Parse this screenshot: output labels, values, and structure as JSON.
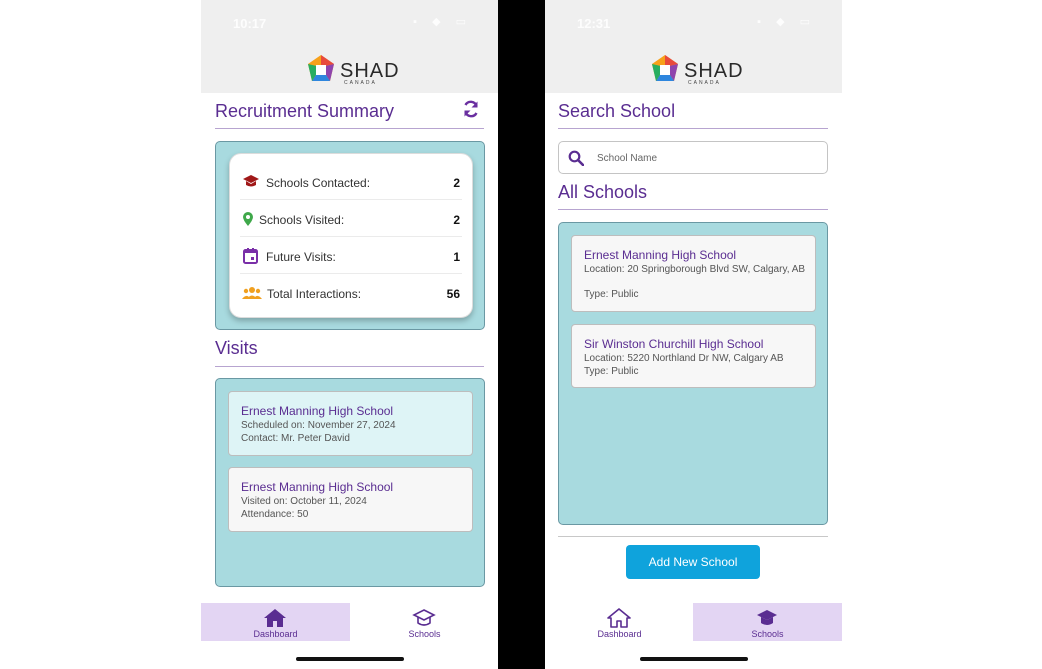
{
  "left_screen": {
    "status_time": "10:17",
    "brand": {
      "name": "SHAD",
      "sub": "CANADA"
    },
    "summary_title": "Recruitment Summary",
    "summary": [
      {
        "icon": "graduation-cap-icon",
        "label": "Schools Contacted:",
        "value": "2"
      },
      {
        "icon": "map-pin-icon",
        "label": "Schools Visited:",
        "value": "2"
      },
      {
        "icon": "calendar-icon",
        "label": "Future Visits:",
        "value": "1"
      },
      {
        "icon": "users-icon",
        "label": "Total Interactions:",
        "value": "56"
      }
    ],
    "visits_title": "Visits",
    "visits": [
      {
        "school": "Ernest Manning High School",
        "line1": "Scheduled on: November 27, 2024",
        "line2": "Contact: Mr. Peter David"
      },
      {
        "school": "Ernest Manning High School",
        "line1": "Visited on: October 11, 2024",
        "line2": "Attendance: 50"
      }
    ],
    "tabs": [
      {
        "label": "Dashboard",
        "icon": "home-icon",
        "active": true
      },
      {
        "label": "Schools",
        "icon": "school-icon",
        "active": false
      }
    ]
  },
  "right_screen": {
    "status_time": "12:31",
    "brand": {
      "name": "SHAD",
      "sub": "CANADA"
    },
    "search_title": "Search School",
    "search_placeholder": "School Name",
    "all_title": "All Schools",
    "schools": [
      {
        "name": "Ernest Manning High School",
        "location": "Location: 20 Springborough Blvd SW, Calgary, AB",
        "type": "Type: Public"
      },
      {
        "name": "Sir Winston Churchill High School",
        "location": "Location: 5220 Northland Dr NW, Calgary AB",
        "type": "Type: Public"
      }
    ],
    "add_button": "Add New School",
    "tabs": [
      {
        "label": "Dashboard",
        "icon": "home-icon",
        "active": false
      },
      {
        "label": "Schools",
        "icon": "school-icon",
        "active": true
      }
    ]
  },
  "colors": {
    "accent": "#5a2d91",
    "panel": "#a8dadf",
    "button": "#0fa3dc",
    "tab_active": "#e3d5f3"
  }
}
